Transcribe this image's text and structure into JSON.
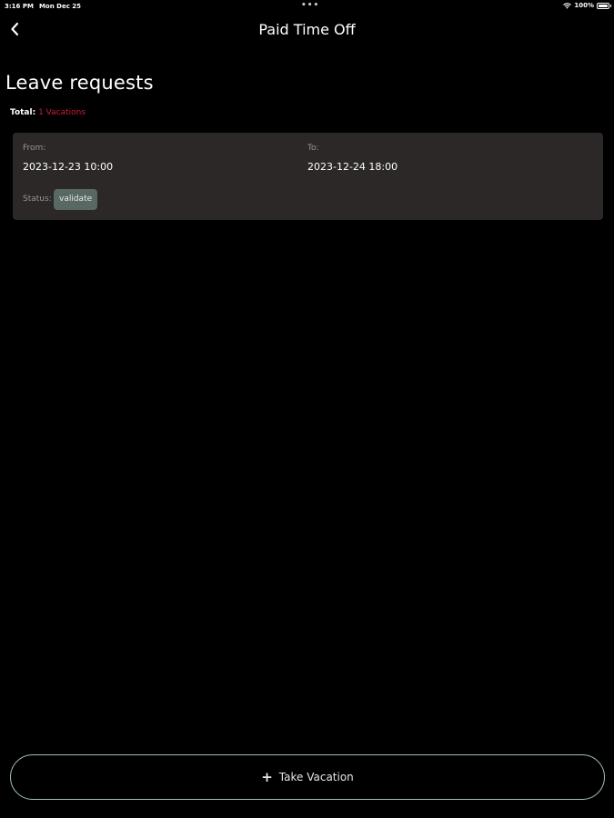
{
  "status_bar": {
    "time": "3:16 PM",
    "date": "Mon Dec 25",
    "dots": "•••",
    "battery": "100%",
    "icons": [
      "wifi-icon",
      "battery-icon"
    ]
  },
  "nav": {
    "title": "Paid Time Off",
    "back_icon": "chevron-left-icon"
  },
  "header": {
    "title": "Leave requests",
    "total_label": "Total:",
    "total_value": "1 Vacations"
  },
  "requests": [
    {
      "from_label": "From:",
      "from_value": "2023-12-23 10:00",
      "to_label": "To:",
      "to_value": "2023-12-24 18:00",
      "status_label": "Status:",
      "status_value": "validate"
    }
  ],
  "footer": {
    "button_label": "Take Vacation",
    "button_icon": "plus-icon"
  },
  "colors": {
    "background": "#000000",
    "card": "#2c2828",
    "accent_red": "#d21a3c",
    "badge": "#586862",
    "button_border": "#9fc4b6"
  }
}
